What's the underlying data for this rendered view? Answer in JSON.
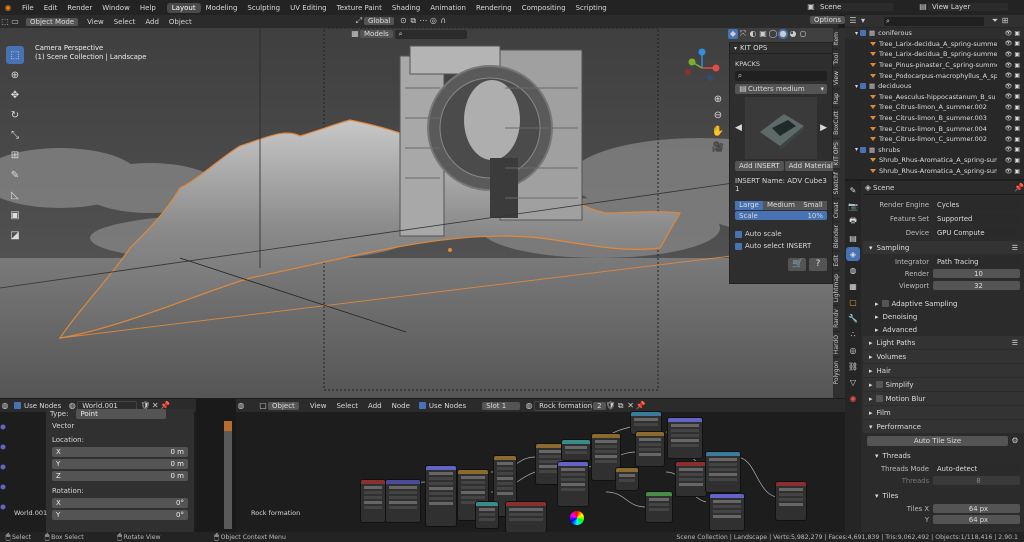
{
  "topbar": {
    "menus": [
      "File",
      "Edit",
      "Render",
      "Window",
      "Help"
    ],
    "workspaces": [
      "Layout",
      "Modeling",
      "Sculpting",
      "UV Editing",
      "Texture Paint",
      "Shading",
      "Animation",
      "Rendering",
      "Compositing",
      "Scripting"
    ],
    "active_workspace": "Layout",
    "scene": "Scene",
    "view_layer": "View Layer"
  },
  "viewport_header": {
    "mode": "Object Mode",
    "menus": [
      "View",
      "Select",
      "Add",
      "Object"
    ],
    "orientation": "Global",
    "options": "Options",
    "collection_filter": "Models"
  },
  "viewport": {
    "camera_label": "Camera Perspective",
    "collection_label": "(1) Scene Collection | Landscape"
  },
  "kitops": {
    "title": "KIT OPS",
    "kpacks_label": "KPACKS",
    "kpack_selected": "Cutters medium",
    "add_insert": "Add INSERT",
    "add_material": "Add Material",
    "insert_name": "INSERT Name: ADV Cube3 1",
    "size_tabs": [
      "Large",
      "Medium",
      "Small"
    ],
    "scale_label": "Scale",
    "scale_value": "10%",
    "auto_scale": "Auto scale",
    "auto_select": "Auto select INSERT"
  },
  "sidebar_tabs": [
    "Item",
    "Tool",
    "View",
    "Rap",
    "BoxCutt",
    "KIT OPS",
    "Sketchf",
    "Creat",
    "Blender",
    "Edit",
    "Lightmap",
    "Randv",
    "HardO",
    "Polygon"
  ],
  "outliner": {
    "rows": [
      {
        "label": "coniferous",
        "indent": 0,
        "kind": "collection"
      },
      {
        "label": "Tree_Larix-decidua_A_spring-summer",
        "indent": 1,
        "kind": "object"
      },
      {
        "label": "Tree_Larix-decidua_B_spring-summer",
        "indent": 1,
        "kind": "object"
      },
      {
        "label": "Tree_Pinus-pinaster_C_spring-summer",
        "indent": 1,
        "kind": "object"
      },
      {
        "label": "Tree_Podocarpus-macrophyllus_A_spring",
        "indent": 1,
        "kind": "object"
      },
      {
        "label": "deciduous",
        "indent": 0,
        "kind": "collection"
      },
      {
        "label": "Tree_Aesculus-hippocastanum_B_su",
        "indent": 1,
        "kind": "object"
      },
      {
        "label": "Tree_Citrus-limon_A_summer.002",
        "indent": 1,
        "kind": "object"
      },
      {
        "label": "Tree_Citrus-limon_B_summer.003",
        "indent": 1,
        "kind": "object"
      },
      {
        "label": "Tree_Citrus-limon_B_summer.004",
        "indent": 1,
        "kind": "object"
      },
      {
        "label": "Tree_Citrus-limon_C_summer.002",
        "indent": 1,
        "kind": "object"
      },
      {
        "label": "shrubs",
        "indent": 0,
        "kind": "collection"
      },
      {
        "label": "Shrub_Rhus-Aromatica_A_spring-sum",
        "indent": 1,
        "kind": "object"
      },
      {
        "label": "Shrub_Rhus-Aromatica_A_spring-sum",
        "indent": 1,
        "kind": "object"
      }
    ]
  },
  "properties": {
    "scene_label": "Scene",
    "render_engine_label": "Render Engine",
    "render_engine": "Cycles",
    "feature_set_label": "Feature Set",
    "feature_set": "Supported",
    "device_label": "Device",
    "device": "GPU Compute",
    "sampling": "Sampling",
    "integrator_label": "Integrator",
    "integrator": "Path Tracing",
    "render_label": "Render",
    "render_samples": "10",
    "viewport_label": "Viewport",
    "viewport_samples": "32",
    "adaptive_sampling": "Adaptive Sampling",
    "denoising": "Denoising",
    "advanced": "Advanced",
    "light_paths": "Light Paths",
    "volumes": "Volumes",
    "hair": "Hair",
    "simplify": "Simplify",
    "motion_blur": "Motion Blur",
    "film": "Film",
    "performance": "Performance",
    "auto_tile_size": "Auto Tile Size",
    "threads": "Threads",
    "threads_mode_label": "Threads Mode",
    "threads_mode": "Auto-detect",
    "threads_label": "Threads",
    "threads_value": "8",
    "tiles": "Tiles",
    "tiles_x_label": "Tiles X",
    "tiles_x": "64 px",
    "tiles_y_label": "Y",
    "tiles_y": "64 px"
  },
  "left_node_panel": {
    "use_nodes": "Use Nodes",
    "world_name": "World.001",
    "type_label": "Type:",
    "type_value": "Point",
    "vector": "Vector",
    "location": "Location:",
    "rotation": "Rotation:",
    "x": "X",
    "y": "Y",
    "z": "Z",
    "loc_x": "0 m",
    "loc_y": "0 m",
    "loc_z": "0 m",
    "rot_x": "0°",
    "rot_y": "0°",
    "world_node_label": "World.001",
    "rock_label": "Rock formation"
  },
  "node_header": {
    "type": "Object",
    "menus": [
      "View",
      "Select",
      "Add",
      "Node"
    ],
    "use_nodes": "Use Nodes",
    "slot": "Slot 1",
    "material": "Rock formation",
    "users": "2"
  },
  "statusbar": {
    "select": "Select",
    "box_select": "Box Select",
    "rotate_view": "Rotate View",
    "context_menu": "Object Context Menu",
    "stats": "Scene Collection | Landscape | Verts:5,982,279 | Faces:4,691,839 | Tris:9,062,492 | Objects:1/118,416 | 2.90.1"
  },
  "colors": {
    "accent": "#4772b3",
    "selection_outline": "#e0883b",
    "header_bg": "#303030"
  }
}
